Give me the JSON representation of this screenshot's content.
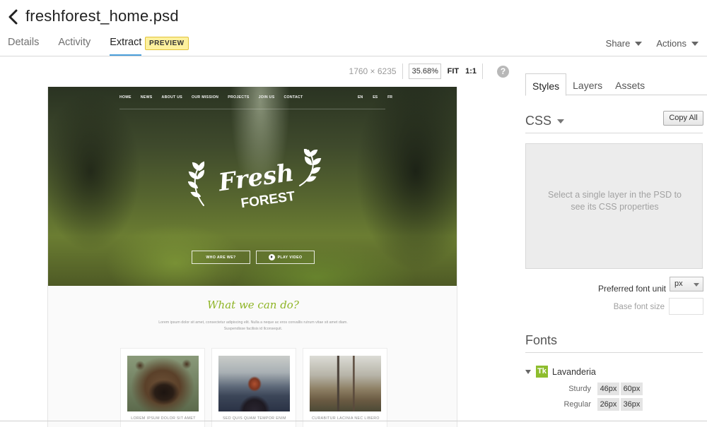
{
  "header": {
    "title": "freshforest_home.psd",
    "tabs": [
      "Details",
      "Activity",
      "Extract"
    ],
    "active_tab": "Extract",
    "preview_badge": "PREVIEW",
    "menus": [
      "Share",
      "Actions"
    ]
  },
  "toolbar": {
    "dimensions": "1760 × 6235",
    "zoom": "35.68%",
    "fit_label": "FIT",
    "one_to_one_label": "1:1",
    "help_glyph": "?"
  },
  "design": {
    "nav": [
      "HOME",
      "NEWS",
      "ABOUT US",
      "OUR MISSION",
      "PROJECTS",
      "JOIN US",
      "CONTACT"
    ],
    "languages": [
      "EN",
      "ES",
      "FR"
    ],
    "logo_line1": "Fresh",
    "logo_line2": "FOREST",
    "buttons": [
      "WHO ARE WE?",
      "PLAY VIDEO"
    ],
    "section_title": "What we can do?",
    "section_desc": "Lorem ipsum dolor sit amet, consectetur adipiscing elit. Nulla a neque ac eros convallis rutrum vitae sit amet diam. Suspendisse facilisis id llconsequit.",
    "cards": [
      {
        "caption": "LOREM IPSUM DOLOR SIT AMET"
      },
      {
        "caption": "SED QUIS QUAM TEMPOR ENIM"
      },
      {
        "caption": "CURABITUR LACINIA NEC LIBERO"
      }
    ]
  },
  "panel": {
    "tabs": [
      "Styles",
      "Layers",
      "Assets"
    ],
    "active_tab": "Styles",
    "css_heading": "CSS",
    "copy_all": "Copy All",
    "css_placeholder": "Select a single layer in the PSD to see its CSS properties",
    "preferred_font_unit_label": "Preferred font unit",
    "preferred_font_unit_value": "px",
    "base_font_size_label": "Base font size",
    "fonts_heading": "Fonts",
    "font": {
      "icon": "Tk",
      "name": "Lavanderia",
      "weights": [
        {
          "label": "Sturdy",
          "sizes": [
            "46px",
            "60px"
          ]
        },
        {
          "label": "Regular",
          "sizes": [
            "26px",
            "36px"
          ]
        }
      ]
    }
  },
  "colors": {
    "tab_underline": "#4a9fdb",
    "badge_bg": "#fdf19e",
    "section_title": "#8fb526",
    "typekit_icon": "#8ebd2e"
  },
  "icons": [
    "back-arrow-icon",
    "chevron-down-icon",
    "help-icon",
    "play-icon",
    "wheat-laurel-icon",
    "typekit-icon",
    "disclosure-triangle-icon"
  ]
}
